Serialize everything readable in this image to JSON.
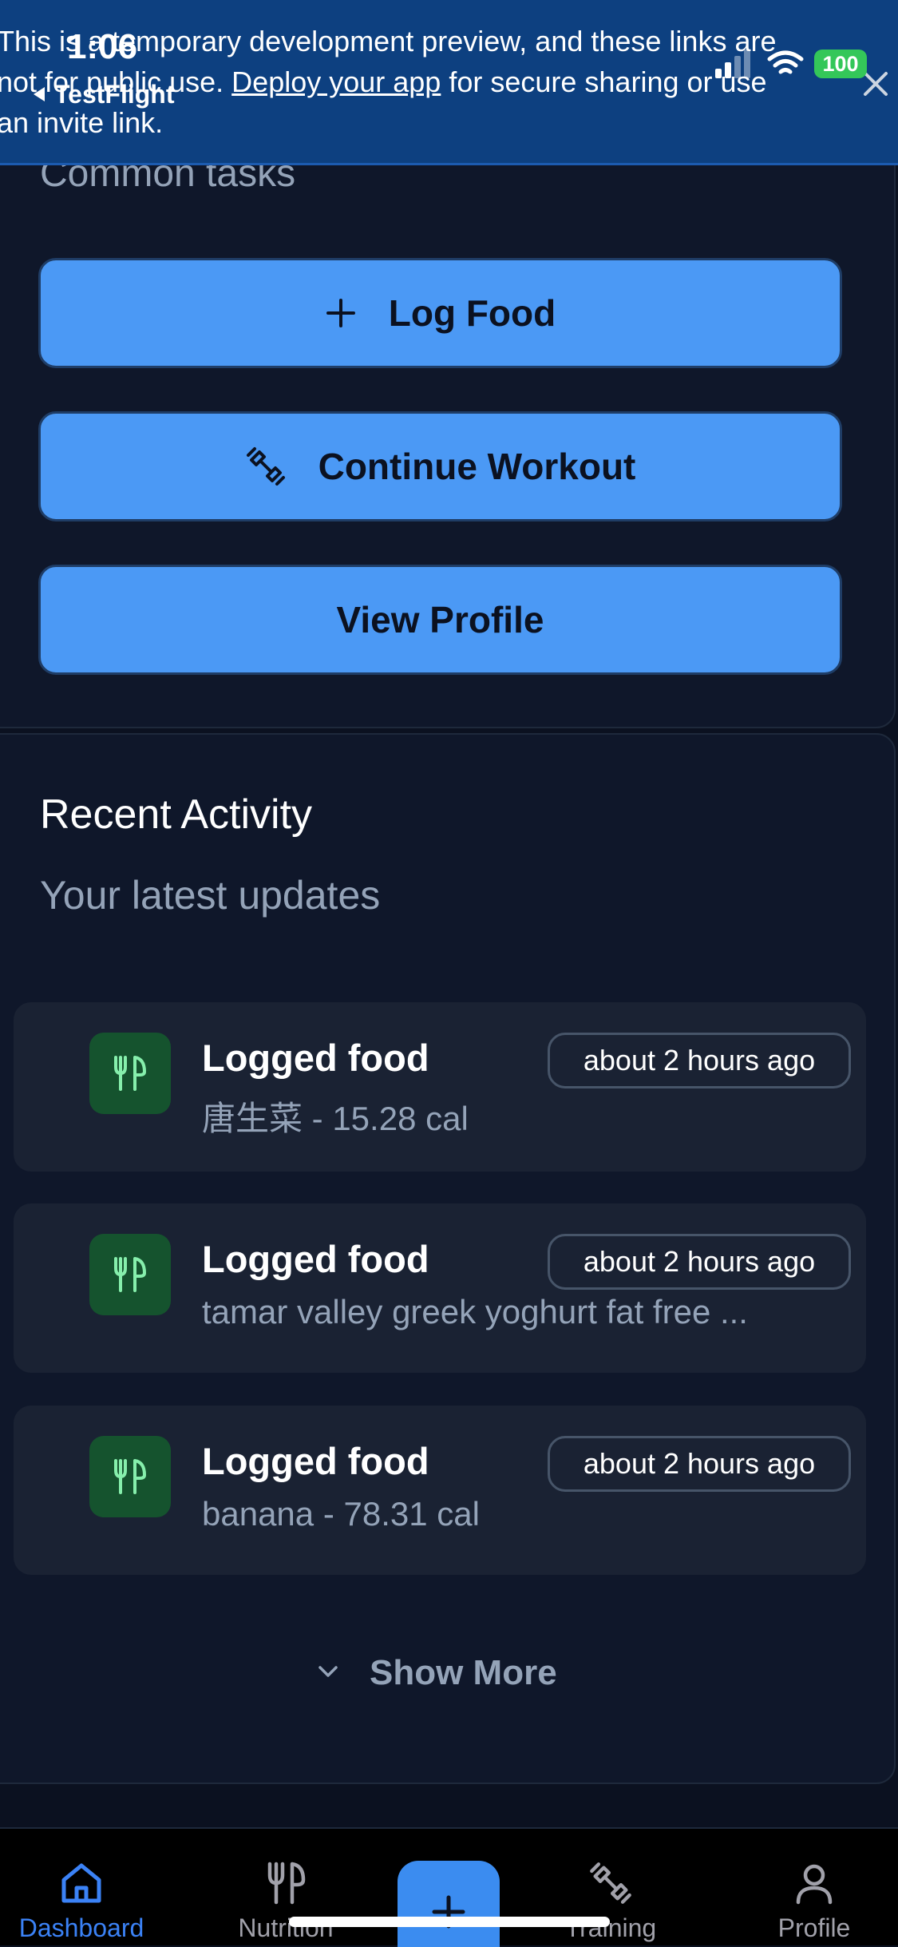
{
  "banner": {
    "text_before": "This is a temporary development preview, and these links are not for public use. ",
    "link": "Deploy your app",
    "text_after": " for secure sharing or use an invite link."
  },
  "status_bar": {
    "time": "1:06",
    "back_label": "TestFlight",
    "battery": "100"
  },
  "quick_actions": {
    "heading": "Common tasks",
    "log_food": "Log Food",
    "continue_workout": "Continue Workout",
    "view_profile": "View Profile"
  },
  "recent_activity": {
    "title": "Recent Activity",
    "subtitle": "Your latest updates",
    "items": [
      {
        "title": "Logged food",
        "desc": "唐生菜 - 15.28 cal",
        "time": "about 2 hours ago"
      },
      {
        "title": "Logged food",
        "desc": "tamar valley greek yoghurt fat free ...",
        "time": "about 2 hours ago"
      },
      {
        "title": "Logged food",
        "desc": "banana - 78.31 cal",
        "time": "about 2 hours ago"
      }
    ],
    "show_more": "Show More"
  },
  "tabs": {
    "dashboard": "Dashboard",
    "nutrition": "Nutrition",
    "training": "Training",
    "profile": "Profile",
    "active": "Dashboard"
  },
  "colors": {
    "accent": "#4b99f5",
    "background": "#0b1120",
    "card": "#0f172a",
    "food_icon_bg": "#15532e",
    "food_icon": "#86efac",
    "banner": "#0d4080"
  },
  "icons": {
    "log_food": "plus-icon",
    "continue_workout": "dumbbell-icon",
    "activity": "utensils-icon",
    "show_more": "chevron-down-icon",
    "banner_close": "close-icon"
  }
}
